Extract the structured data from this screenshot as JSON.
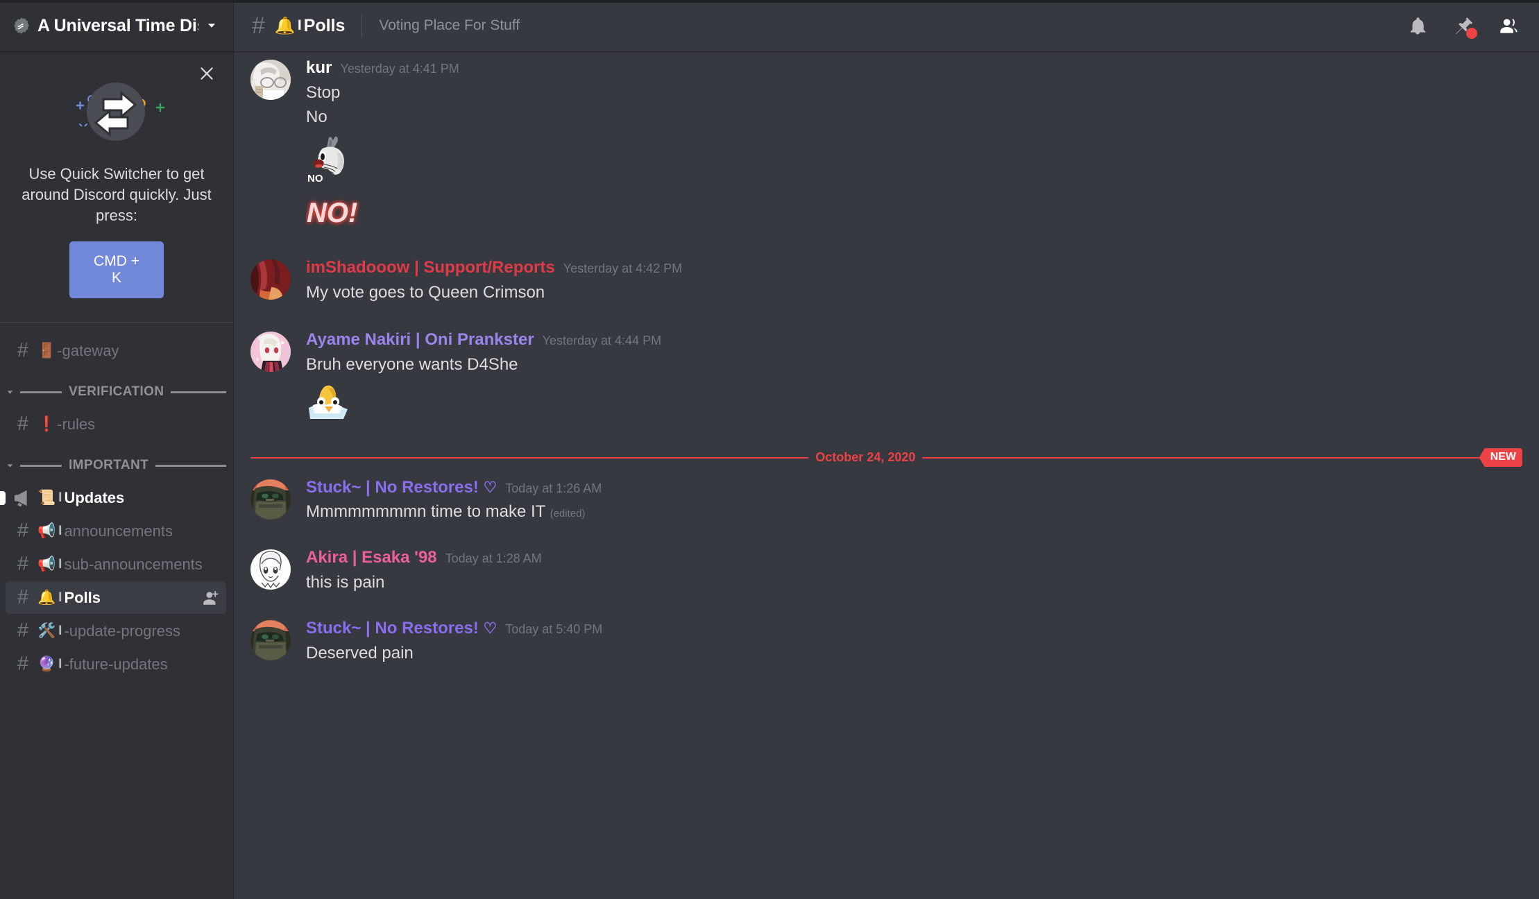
{
  "sidebar": {
    "server": {
      "name": "A Universal Time Disc...",
      "verified_icon": "verified-badge-icon",
      "dropdown_icon": "chevron-down-icon"
    },
    "quick_switcher": {
      "close_icon": "close-icon",
      "art_icon": "swap-arrows-icon",
      "text": "Use Quick Switcher to get around Discord quickly. Just press:",
      "key_label": "CMD + K"
    },
    "items": [
      {
        "type": "channel",
        "icon": "hash-icon",
        "emoji": "🚪",
        "marker": "",
        "name": "-gateway",
        "state": "muted"
      },
      {
        "type": "category",
        "label": "VERIFICATION",
        "icon": "chevron-down-icon"
      },
      {
        "type": "channel",
        "icon": "hash-icon",
        "emoji": "❗",
        "marker": "",
        "name": "-rules",
        "state": "muted"
      },
      {
        "type": "category",
        "label": "IMPORTANT",
        "icon": "chevron-down-icon"
      },
      {
        "type": "announcement",
        "icon": "megaphone-icon",
        "emoji": "📜",
        "marker": "I",
        "name": "Updates",
        "state": "unread"
      },
      {
        "type": "channel",
        "icon": "hash-icon",
        "emoji": "📢",
        "marker": "I",
        "name": "announcements",
        "state": "muted"
      },
      {
        "type": "channel",
        "icon": "hash-icon",
        "emoji": "📢",
        "marker": "I",
        "name": "sub-announcements",
        "state": "muted"
      },
      {
        "type": "channel",
        "icon": "hash-icon",
        "emoji": "🔔",
        "marker": "I",
        "name": "Polls",
        "state": "active",
        "action_icon": "add-member-icon"
      },
      {
        "type": "channel",
        "icon": "hash-icon",
        "emoji": "🛠️",
        "marker": "I",
        "name": "-update-progress",
        "state": "muted"
      },
      {
        "type": "channel",
        "icon": "hash-icon",
        "emoji": "🔮",
        "marker": "I",
        "name": "-future-updates",
        "state": "muted"
      }
    ]
  },
  "topbar": {
    "hash_icon": "hash-icon",
    "channel_emoji": "🔔",
    "channel_marker": "I",
    "channel_name": "Polls",
    "topic": "Voting Place For Stuff",
    "actions": [
      {
        "icon": "bell-icon",
        "name": "notification-settings-button",
        "badge": false
      },
      {
        "icon": "pin-icon",
        "name": "pinned-messages-button",
        "badge": true
      },
      {
        "icon": "members-icon",
        "name": "member-list-button",
        "badge": false
      }
    ]
  },
  "messages": [
    {
      "author": "kur",
      "author_color": "#ffffff",
      "heart": "",
      "timestamp": "Yesterday at 4:41 PM",
      "avatar": "avatar-kur",
      "lines": [
        "Stop",
        "No"
      ],
      "attachments": [
        "bugs-bunny-no-meme",
        "no-exclamation-emote"
      ]
    },
    {
      "author": "imShadooow | Support/Reports",
      "author_color": "#e03a48",
      "heart": "",
      "timestamp": "Yesterday at 4:42 PM",
      "avatar": "avatar-imshadooow",
      "lines": [
        "My vote goes to Queen Crimson"
      ],
      "attachments": []
    },
    {
      "author": "Ayame Nakiri | Oni Prankster",
      "author_color": "#9b84ec",
      "heart": "",
      "timestamp": "Yesterday at 4:44 PM",
      "avatar": "avatar-ayame",
      "lines": [
        "Bruh everyone wants D4She"
      ],
      "attachments": [
        "duck-emote"
      ]
    }
  ],
  "date_divider": {
    "label": "October 24, 2020",
    "new_badge": "NEW",
    "color": "#ed4245"
  },
  "messages_after": [
    {
      "author": "Stuck~ | No Restores!",
      "author_color": "#8b6df0",
      "heart": "♡",
      "timestamp": "Today at 1:26 AM",
      "avatar": "avatar-stuck",
      "lines": [
        "Mmmmmmmmn time to make IT"
      ],
      "edited": "(edited)",
      "attachments": []
    },
    {
      "author": "Akira | Esaka '98",
      "author_color": "#ee5f9a",
      "heart": "",
      "timestamp": "Today at 1:28 AM",
      "avatar": "avatar-akira",
      "lines": [
        "this is pain"
      ],
      "edited": "",
      "attachments": []
    },
    {
      "author": "Stuck~ | No Restores!",
      "author_color": "#8b6df0",
      "heart": "♡",
      "timestamp": "Today at 5:40 PM",
      "avatar": "avatar-stuck",
      "lines": [
        "Deserved pain"
      ],
      "edited": "",
      "attachments": []
    }
  ],
  "colors": {
    "sidebar_bg": "#2f3136",
    "main_bg": "#36393f",
    "blurple": "#7289da",
    "red": "#ed4245",
    "muted_text": "#72767d"
  }
}
